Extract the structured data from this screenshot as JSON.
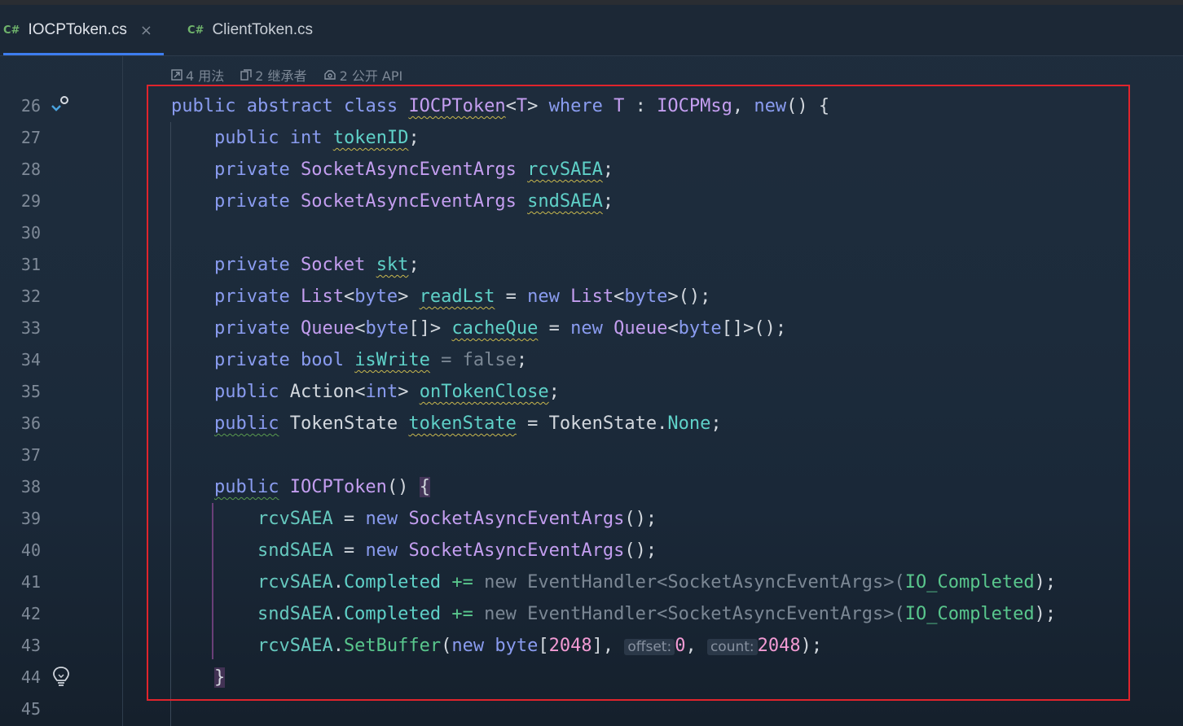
{
  "tabs": [
    {
      "lang": "C#",
      "name": "IOCPToken.cs",
      "close": "×",
      "active": true
    },
    {
      "lang": "C#",
      "name": "ClientToken.cs",
      "active": false
    }
  ],
  "hints": {
    "usages": "4 用法",
    "inheritors": "2 继承者",
    "public_api": "2 公开 API"
  },
  "lines": [
    {
      "n": "26",
      "tokens": [
        [
          "kw",
          "public"
        ],
        [
          "pl",
          " "
        ],
        [
          "kw",
          "abstract"
        ],
        [
          "pl",
          " "
        ],
        [
          "kw",
          "class"
        ],
        [
          "pl",
          " "
        ],
        [
          "ty ul",
          "IOCPToken"
        ],
        [
          "pl",
          "<"
        ],
        [
          "ty",
          "T"
        ],
        [
          "pl",
          "> "
        ],
        [
          "kw",
          "where"
        ],
        [
          "pl",
          " "
        ],
        [
          "ty",
          "T"
        ],
        [
          "pl",
          " : "
        ],
        [
          "ty",
          "IOCPMsg"
        ],
        [
          "pl",
          ", "
        ],
        [
          "kw",
          "new"
        ],
        [
          "pl",
          "() {"
        ]
      ]
    },
    {
      "n": "27",
      "tokens": [
        [
          "pl",
          "    "
        ],
        [
          "kw",
          "public"
        ],
        [
          "pl",
          " "
        ],
        [
          "kw",
          "int"
        ],
        [
          "pl",
          " "
        ],
        [
          "fd ul",
          "tokenID"
        ],
        [
          "pl",
          ";"
        ]
      ]
    },
    {
      "n": "28",
      "tokens": [
        [
          "pl",
          "    "
        ],
        [
          "kw",
          "private"
        ],
        [
          "pl",
          " "
        ],
        [
          "ty",
          "SocketAsyncEventArgs"
        ],
        [
          "pl",
          " "
        ],
        [
          "fd ul",
          "rcvSAEA"
        ],
        [
          "pl",
          ";"
        ]
      ]
    },
    {
      "n": "29",
      "tokens": [
        [
          "pl",
          "    "
        ],
        [
          "kw",
          "private"
        ],
        [
          "pl",
          " "
        ],
        [
          "ty",
          "SocketAsyncEventArgs"
        ],
        [
          "pl",
          " "
        ],
        [
          "fd ul",
          "sndSAEA"
        ],
        [
          "pl",
          ";"
        ]
      ]
    },
    {
      "n": "30",
      "tokens": []
    },
    {
      "n": "31",
      "tokens": [
        [
          "pl",
          "    "
        ],
        [
          "kw",
          "private"
        ],
        [
          "pl",
          " "
        ],
        [
          "ty",
          "Socket"
        ],
        [
          "pl",
          " "
        ],
        [
          "fd ul",
          "skt"
        ],
        [
          "pl",
          ";"
        ]
      ]
    },
    {
      "n": "32",
      "tokens": [
        [
          "pl",
          "    "
        ],
        [
          "kw",
          "private"
        ],
        [
          "pl",
          " "
        ],
        [
          "ty",
          "List"
        ],
        [
          "pl",
          "<"
        ],
        [
          "kw",
          "byte"
        ],
        [
          "pl",
          "> "
        ],
        [
          "fd ul",
          "readLst"
        ],
        [
          "pl",
          " = "
        ],
        [
          "kw",
          "new"
        ],
        [
          "pl",
          " "
        ],
        [
          "ty",
          "List"
        ],
        [
          "pl",
          "<"
        ],
        [
          "kw",
          "byte"
        ],
        [
          "pl",
          ">();"
        ]
      ]
    },
    {
      "n": "33",
      "tokens": [
        [
          "pl",
          "    "
        ],
        [
          "kw",
          "private"
        ],
        [
          "pl",
          " "
        ],
        [
          "ty",
          "Queue"
        ],
        [
          "pl",
          "<"
        ],
        [
          "kw",
          "byte"
        ],
        [
          "pl",
          "[]> "
        ],
        [
          "fd ul",
          "cacheQue"
        ],
        [
          "pl",
          " = "
        ],
        [
          "kw",
          "new"
        ],
        [
          "pl",
          " "
        ],
        [
          "ty",
          "Queue"
        ],
        [
          "pl",
          "<"
        ],
        [
          "kw",
          "byte"
        ],
        [
          "pl",
          "[]>();"
        ]
      ]
    },
    {
      "n": "34",
      "tokens": [
        [
          "pl",
          "    "
        ],
        [
          "kw",
          "private"
        ],
        [
          "pl",
          " "
        ],
        [
          "kw",
          "bool"
        ],
        [
          "pl",
          " "
        ],
        [
          "fd ul",
          "isWrite"
        ],
        [
          "dim",
          " = false"
        ],
        [
          "pl",
          ";"
        ]
      ]
    },
    {
      "n": "35",
      "tokens": [
        [
          "pl",
          "    "
        ],
        [
          "kw",
          "public"
        ],
        [
          "pl",
          " "
        ],
        [
          "pl",
          "Action"
        ],
        [
          "pl",
          "<"
        ],
        [
          "kw",
          "int"
        ],
        [
          "pl",
          "> "
        ],
        [
          "fd ul",
          "onTokenClose"
        ],
        [
          "pl",
          ";"
        ]
      ]
    },
    {
      "n": "36",
      "tokens": [
        [
          "pl",
          "    "
        ],
        [
          "kw ulg",
          "public"
        ],
        [
          "pl",
          " "
        ],
        [
          "pl",
          "TokenState"
        ],
        [
          "pl",
          " "
        ],
        [
          "fd ul",
          "tokenState"
        ],
        [
          "pl",
          " = "
        ],
        [
          "pl",
          "TokenState"
        ],
        [
          "pl",
          "."
        ],
        [
          "fd",
          "None"
        ],
        [
          "pl",
          ";"
        ]
      ]
    },
    {
      "n": "37",
      "tokens": []
    },
    {
      "n": "38",
      "tokens": [
        [
          "pl",
          "    "
        ],
        [
          "kw ulg",
          "public"
        ],
        [
          "pl",
          " "
        ],
        [
          "ty",
          "IOCPToken"
        ],
        [
          "pl",
          "() "
        ],
        [
          "pl brace-hl",
          "{"
        ]
      ]
    },
    {
      "n": "39",
      "tokens": [
        [
          "pl",
          "        "
        ],
        [
          "fdl",
          "rcvSAEA"
        ],
        [
          "pl",
          " = "
        ],
        [
          "kw",
          "new"
        ],
        [
          "pl",
          " "
        ],
        [
          "ty",
          "SocketAsyncEventArgs"
        ],
        [
          "pl",
          "();"
        ]
      ]
    },
    {
      "n": "40",
      "tokens": [
        [
          "pl",
          "        "
        ],
        [
          "fdl",
          "sndSAEA"
        ],
        [
          "pl",
          " = "
        ],
        [
          "kw",
          "new"
        ],
        [
          "pl",
          " "
        ],
        [
          "ty",
          "SocketAsyncEventArgs"
        ],
        [
          "pl",
          "();"
        ]
      ]
    },
    {
      "n": "41",
      "tokens": [
        [
          "pl",
          "        "
        ],
        [
          "fdl",
          "rcvSAEA"
        ],
        [
          "pl",
          "."
        ],
        [
          "ev",
          "Completed"
        ],
        [
          "pl",
          " "
        ],
        [
          "mt",
          "+="
        ],
        [
          "pl",
          " "
        ],
        [
          "dim",
          "new EventHandler<SocketAsyncEventArgs>("
        ],
        [
          "mt",
          "IO_Completed"
        ],
        [
          "pl",
          ");"
        ]
      ]
    },
    {
      "n": "42",
      "tokens": [
        [
          "pl",
          "        "
        ],
        [
          "fdl",
          "sndSAEA"
        ],
        [
          "pl",
          "."
        ],
        [
          "ev",
          "Completed"
        ],
        [
          "pl",
          " "
        ],
        [
          "mt",
          "+="
        ],
        [
          "pl",
          " "
        ],
        [
          "dim",
          "new EventHandler<SocketAsyncEventArgs>("
        ],
        [
          "mt",
          "IO_Completed"
        ],
        [
          "pl",
          ");"
        ]
      ]
    },
    {
      "n": "43",
      "tokens": [
        [
          "pl",
          "        "
        ],
        [
          "fdl",
          "rcvSAEA"
        ],
        [
          "pl",
          "."
        ],
        [
          "mt",
          "SetBuffer"
        ],
        [
          "pl",
          "("
        ],
        [
          "kw",
          "new"
        ],
        [
          "pl",
          " "
        ],
        [
          "kw",
          "byte"
        ],
        [
          "pl",
          "["
        ],
        [
          "num",
          "2048"
        ],
        [
          "pl",
          "], "
        ],
        [
          "param",
          "offset:"
        ],
        [
          "num",
          "0"
        ],
        [
          "pl",
          ", "
        ],
        [
          "param",
          "count:"
        ],
        [
          "num",
          "2048"
        ],
        [
          "pl",
          ");"
        ]
      ]
    },
    {
      "n": "44",
      "tokens": [
        [
          "pl",
          "    "
        ],
        [
          "pl brace-hl",
          "}"
        ]
      ]
    },
    {
      "n": "45",
      "tokens": []
    }
  ]
}
